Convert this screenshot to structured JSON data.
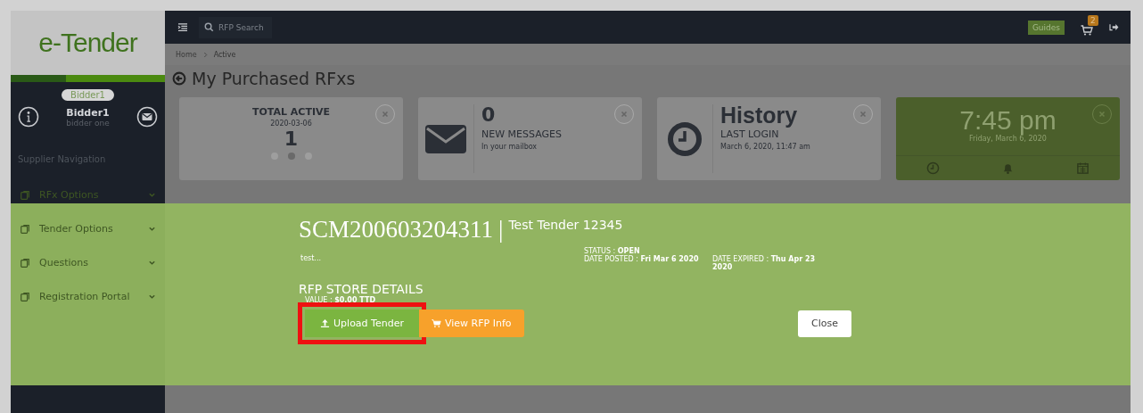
{
  "logo": {
    "text": "e-Tender"
  },
  "topbar": {
    "search_placeholder": "RFP Search",
    "guides": "Guides",
    "cart_count": "2"
  },
  "breadcrumb": [
    "Home",
    "Active"
  ],
  "page_title": "My Purchased RFxs",
  "sidebar": {
    "user_tag": "Bidder1",
    "user_name": "Bidder1",
    "user_subtitle": "bidder one",
    "section": "Supplier Navigation",
    "items": [
      {
        "label": "RFx Options"
      },
      {
        "label": "Tender Options"
      },
      {
        "label": "Questions"
      },
      {
        "label": "Registration Portal"
      }
    ]
  },
  "cards": [
    {
      "kind": "total",
      "title": "TOTAL ACTIVE",
      "date": "2020-03-06",
      "value": "1",
      "dots": [
        {
          "selected": false
        },
        {
          "selected": true
        },
        {
          "selected": false
        }
      ]
    },
    {
      "kind": "messages",
      "value": "0",
      "title": "NEW MESSAGES",
      "subtitle": "In your mailbox"
    },
    {
      "kind": "history",
      "value": "History",
      "title": "LAST LOGIN",
      "subtitle": "March 6, 2020, 11:47 am"
    },
    {
      "kind": "clock",
      "value": "7:45 pm",
      "subtitle": "Friday, March 6, 2020"
    }
  ],
  "modal": {
    "reference": "SCM200603204311",
    "separator": "|",
    "title": "Test Tender 12345",
    "description": "test...",
    "status_label": "STATUS :",
    "status": "OPEN",
    "posted_label": "DATE POSTED :",
    "posted": "Fri Mar 6 2020",
    "expired_label": "DATE EXPIRED :",
    "expired": "Thu Apr 23 2020",
    "store_heading": "RFP STORE DETAILS",
    "value_label": "VALUE :",
    "value": "$0.00 TTD",
    "buttons": [
      {
        "kind": "upload",
        "label": "Upload Tender",
        "highlighted": true
      },
      {
        "kind": "info",
        "label": "View RFP Info",
        "highlighted": false
      }
    ],
    "close": "Close"
  }
}
